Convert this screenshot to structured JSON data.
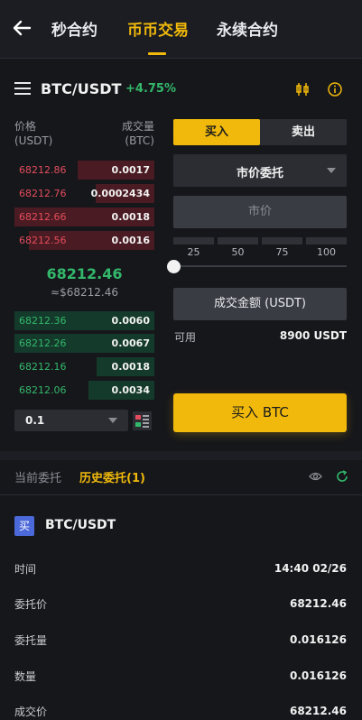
{
  "header": {
    "tabs": [
      {
        "label": "秒合约",
        "active": false
      },
      {
        "label": "币币交易",
        "active": true
      },
      {
        "label": "永续合约",
        "active": false
      }
    ]
  },
  "market": {
    "pair": "BTC/USDT",
    "change": "+4.75%"
  },
  "orderbook": {
    "price_header": "价格\n(USDT)",
    "amount_header": "成交量\n(BTC)",
    "price_header_line1": "价格",
    "price_header_line2": "(USDT)",
    "amount_header_line1": "成交量",
    "amount_header_line2": "(BTC)",
    "asks": [
      {
        "price": "68212.86",
        "amount": "0.0017",
        "depth": 0.55
      },
      {
        "price": "68212.76",
        "amount": "0.0002434",
        "depth": 0.42
      },
      {
        "price": "68212.66",
        "amount": "0.0018",
        "depth": 1.0
      },
      {
        "price": "68212.56",
        "amount": "0.0016",
        "depth": 0.9
      }
    ],
    "last_price": "68212.46",
    "last_price_ref": "≈$68212.46",
    "bids": [
      {
        "price": "68212.36",
        "amount": "0.0060",
        "depth": 1.0
      },
      {
        "price": "68212.26",
        "amount": "0.0067",
        "depth": 1.0
      },
      {
        "price": "68212.16",
        "amount": "0.0018",
        "depth": 0.41
      },
      {
        "price": "68212.06",
        "amount": "0.0034",
        "depth": 0.47
      }
    ],
    "precision": "0.1"
  },
  "trade_form": {
    "buy_tab": "买入",
    "sell_tab": "卖出",
    "order_type": "市价委托",
    "price_placeholder": "市价",
    "percent_options": [
      "25",
      "50",
      "75",
      "100"
    ],
    "slider_value": 0,
    "amount_placeholder": "成交金额 (USDT)",
    "available_label": "可用",
    "available_value": "8900 USDT",
    "submit_label": "买入 BTC"
  },
  "orders": {
    "tab_current": "当前委托",
    "tab_history": "历史委托(1)",
    "badge": "买",
    "pair": "BTC/USDT",
    "details": [
      {
        "label": "时间",
        "value": "14:40 02/26"
      },
      {
        "label": "委托价",
        "value": "68212.46"
      },
      {
        "label": "委托量",
        "value": "0.016126"
      },
      {
        "label": "数量",
        "value": "0.016126"
      },
      {
        "label": "成交价",
        "value": "68212.46"
      }
    ]
  },
  "colors": {
    "accent": "#f0b90b",
    "up": "#33b86b",
    "down": "#e24c5c",
    "badge": "#4b69d9"
  }
}
